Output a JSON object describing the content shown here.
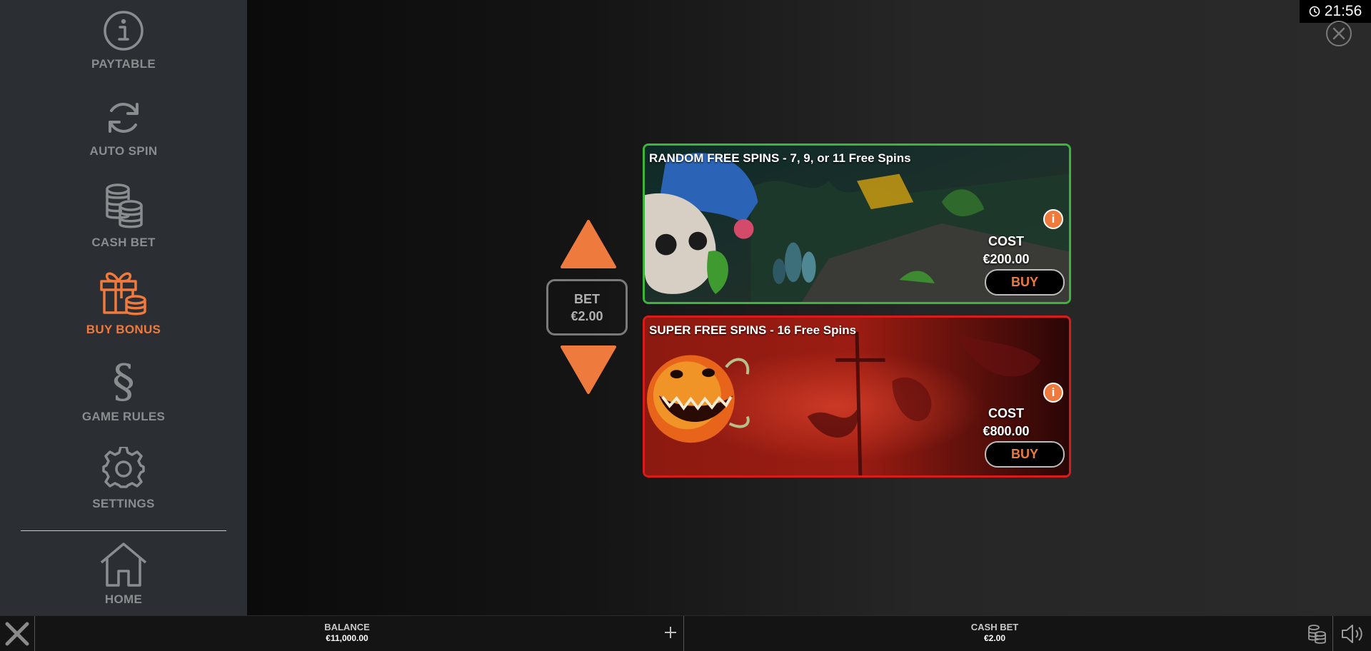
{
  "clock": {
    "time": "21:56"
  },
  "sidebar": {
    "items": [
      {
        "label": "PAYTABLE",
        "icon": "info-icon",
        "active": false
      },
      {
        "label": "AUTO SPIN",
        "icon": "refresh-icon",
        "active": false
      },
      {
        "label": "CASH BET",
        "icon": "coins-icon",
        "active": false
      },
      {
        "label": "BUY BONUS",
        "icon": "gift-coins-icon",
        "active": true
      },
      {
        "label": "GAME RULES",
        "icon": "section-sign-icon",
        "active": false
      },
      {
        "label": "SETTINGS",
        "icon": "gear-icon",
        "active": false
      },
      {
        "label": "HOME",
        "icon": "home-icon",
        "active": false
      }
    ]
  },
  "bet": {
    "label": "BET",
    "value": "€2.00"
  },
  "offers": [
    {
      "title": "RANDOM FREE SPINS - 7, 9, or 11 Free Spins",
      "cost_label": "COST",
      "cost_value": "€200.00",
      "buy_label": "BUY",
      "border_color": "#3db43a"
    },
    {
      "title": "SUPER FREE SPINS - 16 Free Spins",
      "cost_label": "COST",
      "cost_value": "€800.00",
      "buy_label": "BUY",
      "border_color": "#d81c1c"
    }
  ],
  "bottom_bar": {
    "balance_label": "BALANCE",
    "balance_value": "€11,000.00",
    "cash_bet_label": "CASH BET",
    "cash_bet_value": "€2.00"
  },
  "colors": {
    "accent": "#ee7a3e",
    "sidebar_bg": "#2b2f33",
    "sidebar_text": "#8a8d90"
  }
}
